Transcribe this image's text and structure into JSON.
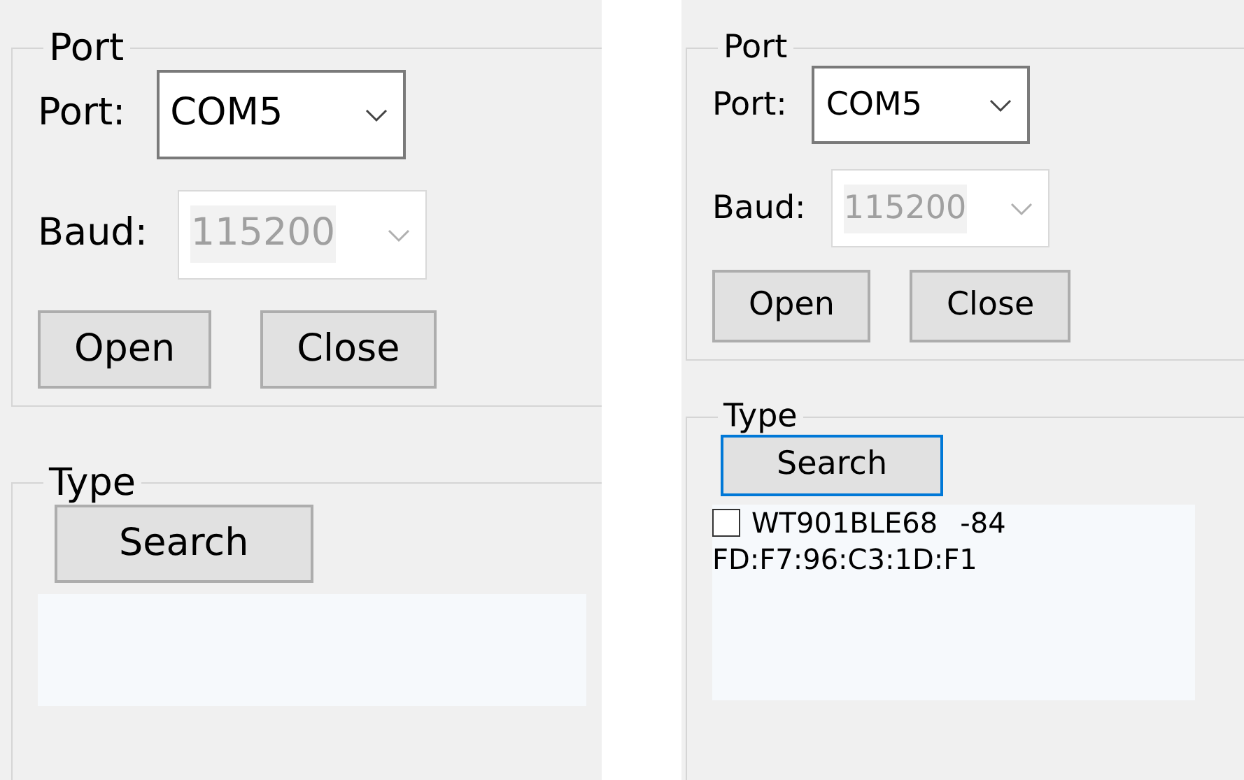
{
  "panels": [
    {
      "port": {
        "title": "Port",
        "port_label": "Port:",
        "port_value": "COM5",
        "baud_label": "Baud:",
        "baud_value": "115200",
        "baud_disabled": true,
        "buttons": [
          "Open",
          "Close"
        ]
      },
      "type": {
        "title": "Type",
        "search_button": "Search",
        "search_focused": false
      }
    },
    {
      "port": {
        "title": "Port",
        "port_label": "Port:",
        "port_value": "COM5",
        "baud_label": "Baud:",
        "baud_value": "115200",
        "baud_disabled": true,
        "buttons": [
          "Open",
          "Close"
        ]
      },
      "type": {
        "title": "Type",
        "search_button": "Search",
        "search_focused": true,
        "devices": [
          {
            "checked": false,
            "name": "WT901BLE68",
            "rssi": "-84",
            "address": "FD:F7:96:C3:1D:F1"
          }
        ]
      }
    }
  ]
}
